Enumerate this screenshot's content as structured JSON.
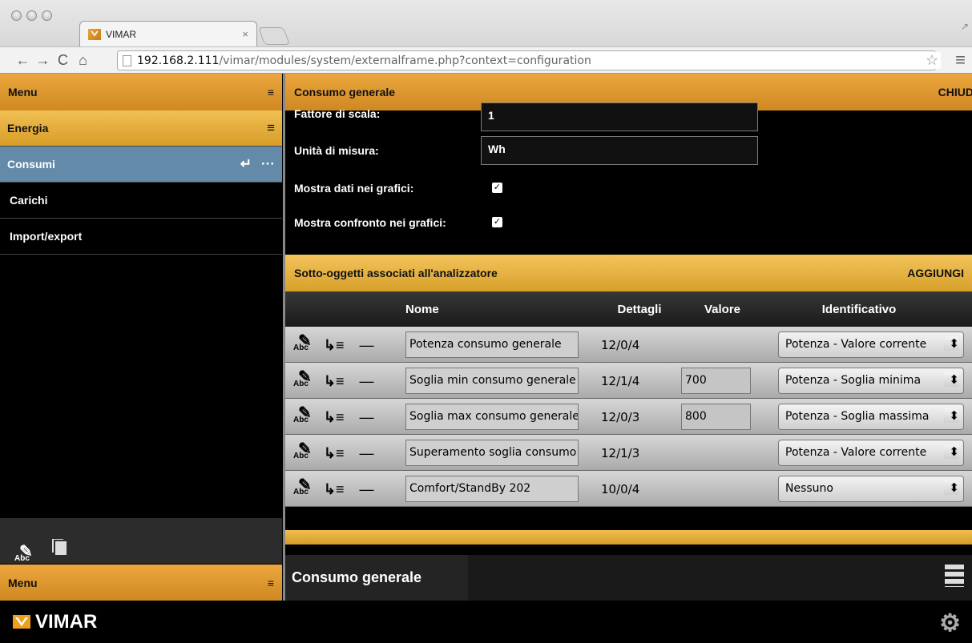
{
  "browser": {
    "tab_title": "VIMAR",
    "tab_close": "×",
    "address_host": "192.168.2.111",
    "address_path": "/vimar/modules/system/externalframe.php?context=configuration",
    "resize_icon": "↗",
    "icons": {
      "back": "←",
      "forward": "→",
      "reload": "C",
      "home": "⌂",
      "star": "☆",
      "menu": "≡"
    }
  },
  "sidebar": {
    "menu_title": "Menu",
    "menu_icon": "≡",
    "items": [
      {
        "label": "Energia",
        "icon": "≡",
        "active": true
      },
      {
        "label": "Consumi",
        "icon": "↵",
        "secondary_icon": "···",
        "selected": true
      },
      {
        "label": "Carichi"
      },
      {
        "label": "Import/export"
      }
    ],
    "edit_label": "Abc",
    "bottom_menu_title": "Menu",
    "bottom_menu_icon": "≡"
  },
  "main": {
    "title": "Consumo generale",
    "close_label": "CHIUD",
    "fields": [
      {
        "label": "Fattore di scala:",
        "value": "1"
      },
      {
        "label": "Unità di misura:",
        "value": "Wh"
      },
      {
        "label": "Mostra dati nei grafici:",
        "checked": "✓"
      },
      {
        "label": "Mostra confronto nei grafici:",
        "checked": "✓"
      }
    ],
    "section_title": "Sotto-oggetti associati all'analizzatore",
    "add_label": "AGGIUNGI",
    "columns": [
      "Nome",
      "Dettagli",
      "Valore",
      "Identificativo"
    ],
    "rows": [
      {
        "name": "Potenza consumo generale",
        "details": "12/0/4",
        "value": "",
        "identifier": "Potenza - Valore corrente"
      },
      {
        "name": "Soglia min consumo generale",
        "details": "12/1/4",
        "value": "700",
        "identifier": "Potenza - Soglia minima"
      },
      {
        "name": "Soglia max consumo generale",
        "details": "12/0/3",
        "value": "800",
        "identifier": "Potenza - Soglia massima"
      },
      {
        "name": "Superamento soglia consumo",
        "details": "12/1/3",
        "value": "",
        "identifier": "Potenza - Valore corrente"
      },
      {
        "name": "Comfort/StandBy 202",
        "details": "10/0/4",
        "value": "",
        "identifier": "Nessuno"
      }
    ],
    "row_tools": {
      "edit": "Abc",
      "link": "↳≡",
      "remove": "—"
    }
  },
  "bottom": {
    "tab": "Consumo generale"
  },
  "footer": {
    "brand": "VIMAR",
    "settings_icon": "⚙"
  },
  "colors": {
    "accent": "#e39b2f",
    "selected": "#648aa9"
  }
}
